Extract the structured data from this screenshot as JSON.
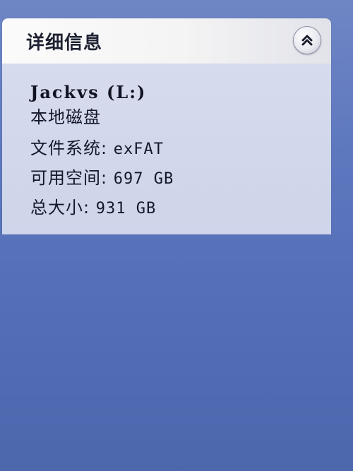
{
  "details_pane": {
    "title": "详细信息",
    "collapse_icon": "double-chevron-up-icon",
    "drive_name": "Jackvs (L:)",
    "drive_type": "本地磁盘",
    "file_system_label": "文件系统: ",
    "file_system_value": "exFAT",
    "free_space_label": "可用空间: ",
    "free_space_value": "697 GB",
    "total_size_label": "总大小: ",
    "total_size_value": "931 GB"
  },
  "colors": {
    "background": "#5f79bf",
    "header_bg": "#f4f4f4",
    "body_bg": "#d3d9ec",
    "text": "#15182a"
  }
}
